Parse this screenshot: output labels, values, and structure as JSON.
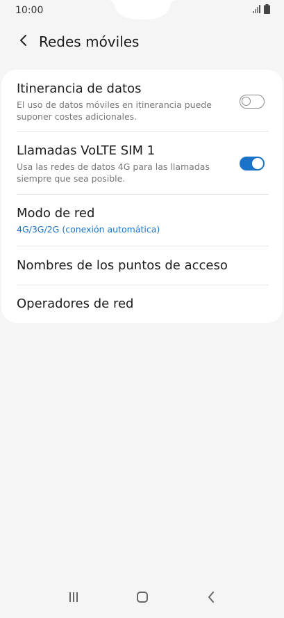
{
  "status_bar": {
    "time": "10:00"
  },
  "header": {
    "title": "Redes móviles"
  },
  "settings": [
    {
      "title": "Itinerancia de datos",
      "subtitle": "El uso de datos móviles en itinerancia puede suponer costes adicionales.",
      "toggle": "off"
    },
    {
      "title": "Llamadas VoLTE SIM 1",
      "subtitle": "Usa las redes de datos 4G para las llamadas siempre que sea posible.",
      "toggle": "on"
    },
    {
      "title": "Modo de red",
      "subtitle": "4G/3G/2G (conexión automática)"
    },
    {
      "title": "Nombres de los puntos de acceso"
    },
    {
      "title": "Operadores de red"
    }
  ],
  "colors": {
    "accent": "#1a73c8",
    "background": "#f5f5f5",
    "card": "#ffffff"
  },
  "icons": {
    "back": "chevron-left-icon",
    "signal": "signal-icon",
    "battery": "battery-icon",
    "recents": "recents-icon",
    "home": "home-icon",
    "nav_back": "nav-back-icon"
  }
}
